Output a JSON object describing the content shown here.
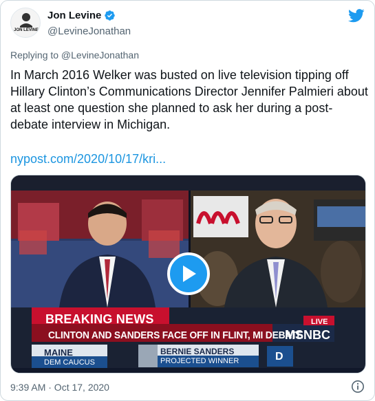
{
  "author": {
    "name": "Jon Levine",
    "handle": "@LevineJonathan",
    "avatar_text": "JON LEVINE",
    "verified": true
  },
  "reply_to": "Replying to @LevineJonathan",
  "tweet_text": "In March 2016 Welker was busted on live television tipping off Hillary Clinton’s Communications Director Jennifer Palmieri about at least one question she planned to ask her during a post-debate interview in Michigan.",
  "link_text": "nypost.com/2020/10/17/kri...",
  "media": {
    "breaking_label": "BREAKING NEWS",
    "headline": "CLINTON AND SANDERS FACE OFF IN FLINT, MI DEBATE",
    "network": "MSNBC",
    "live_label": "LIVE",
    "state": "MAINE",
    "caucus": "DEM CAUCUS",
    "candidate": "BERNIE SANDERS",
    "result": "PROJECTED WINNER",
    "party": "D"
  },
  "timestamp": "9:39 AM · Oct 17, 2020",
  "icons": [
    "verified-badge-icon",
    "twitter-bird-icon",
    "play-icon",
    "info-icon"
  ],
  "colors": {
    "brand_blue": "#1d9bf0",
    "link_blue": "#1b95e0",
    "text_primary": "#0f1419",
    "text_secondary": "#536471",
    "breaking_red": "#c8102e"
  }
}
